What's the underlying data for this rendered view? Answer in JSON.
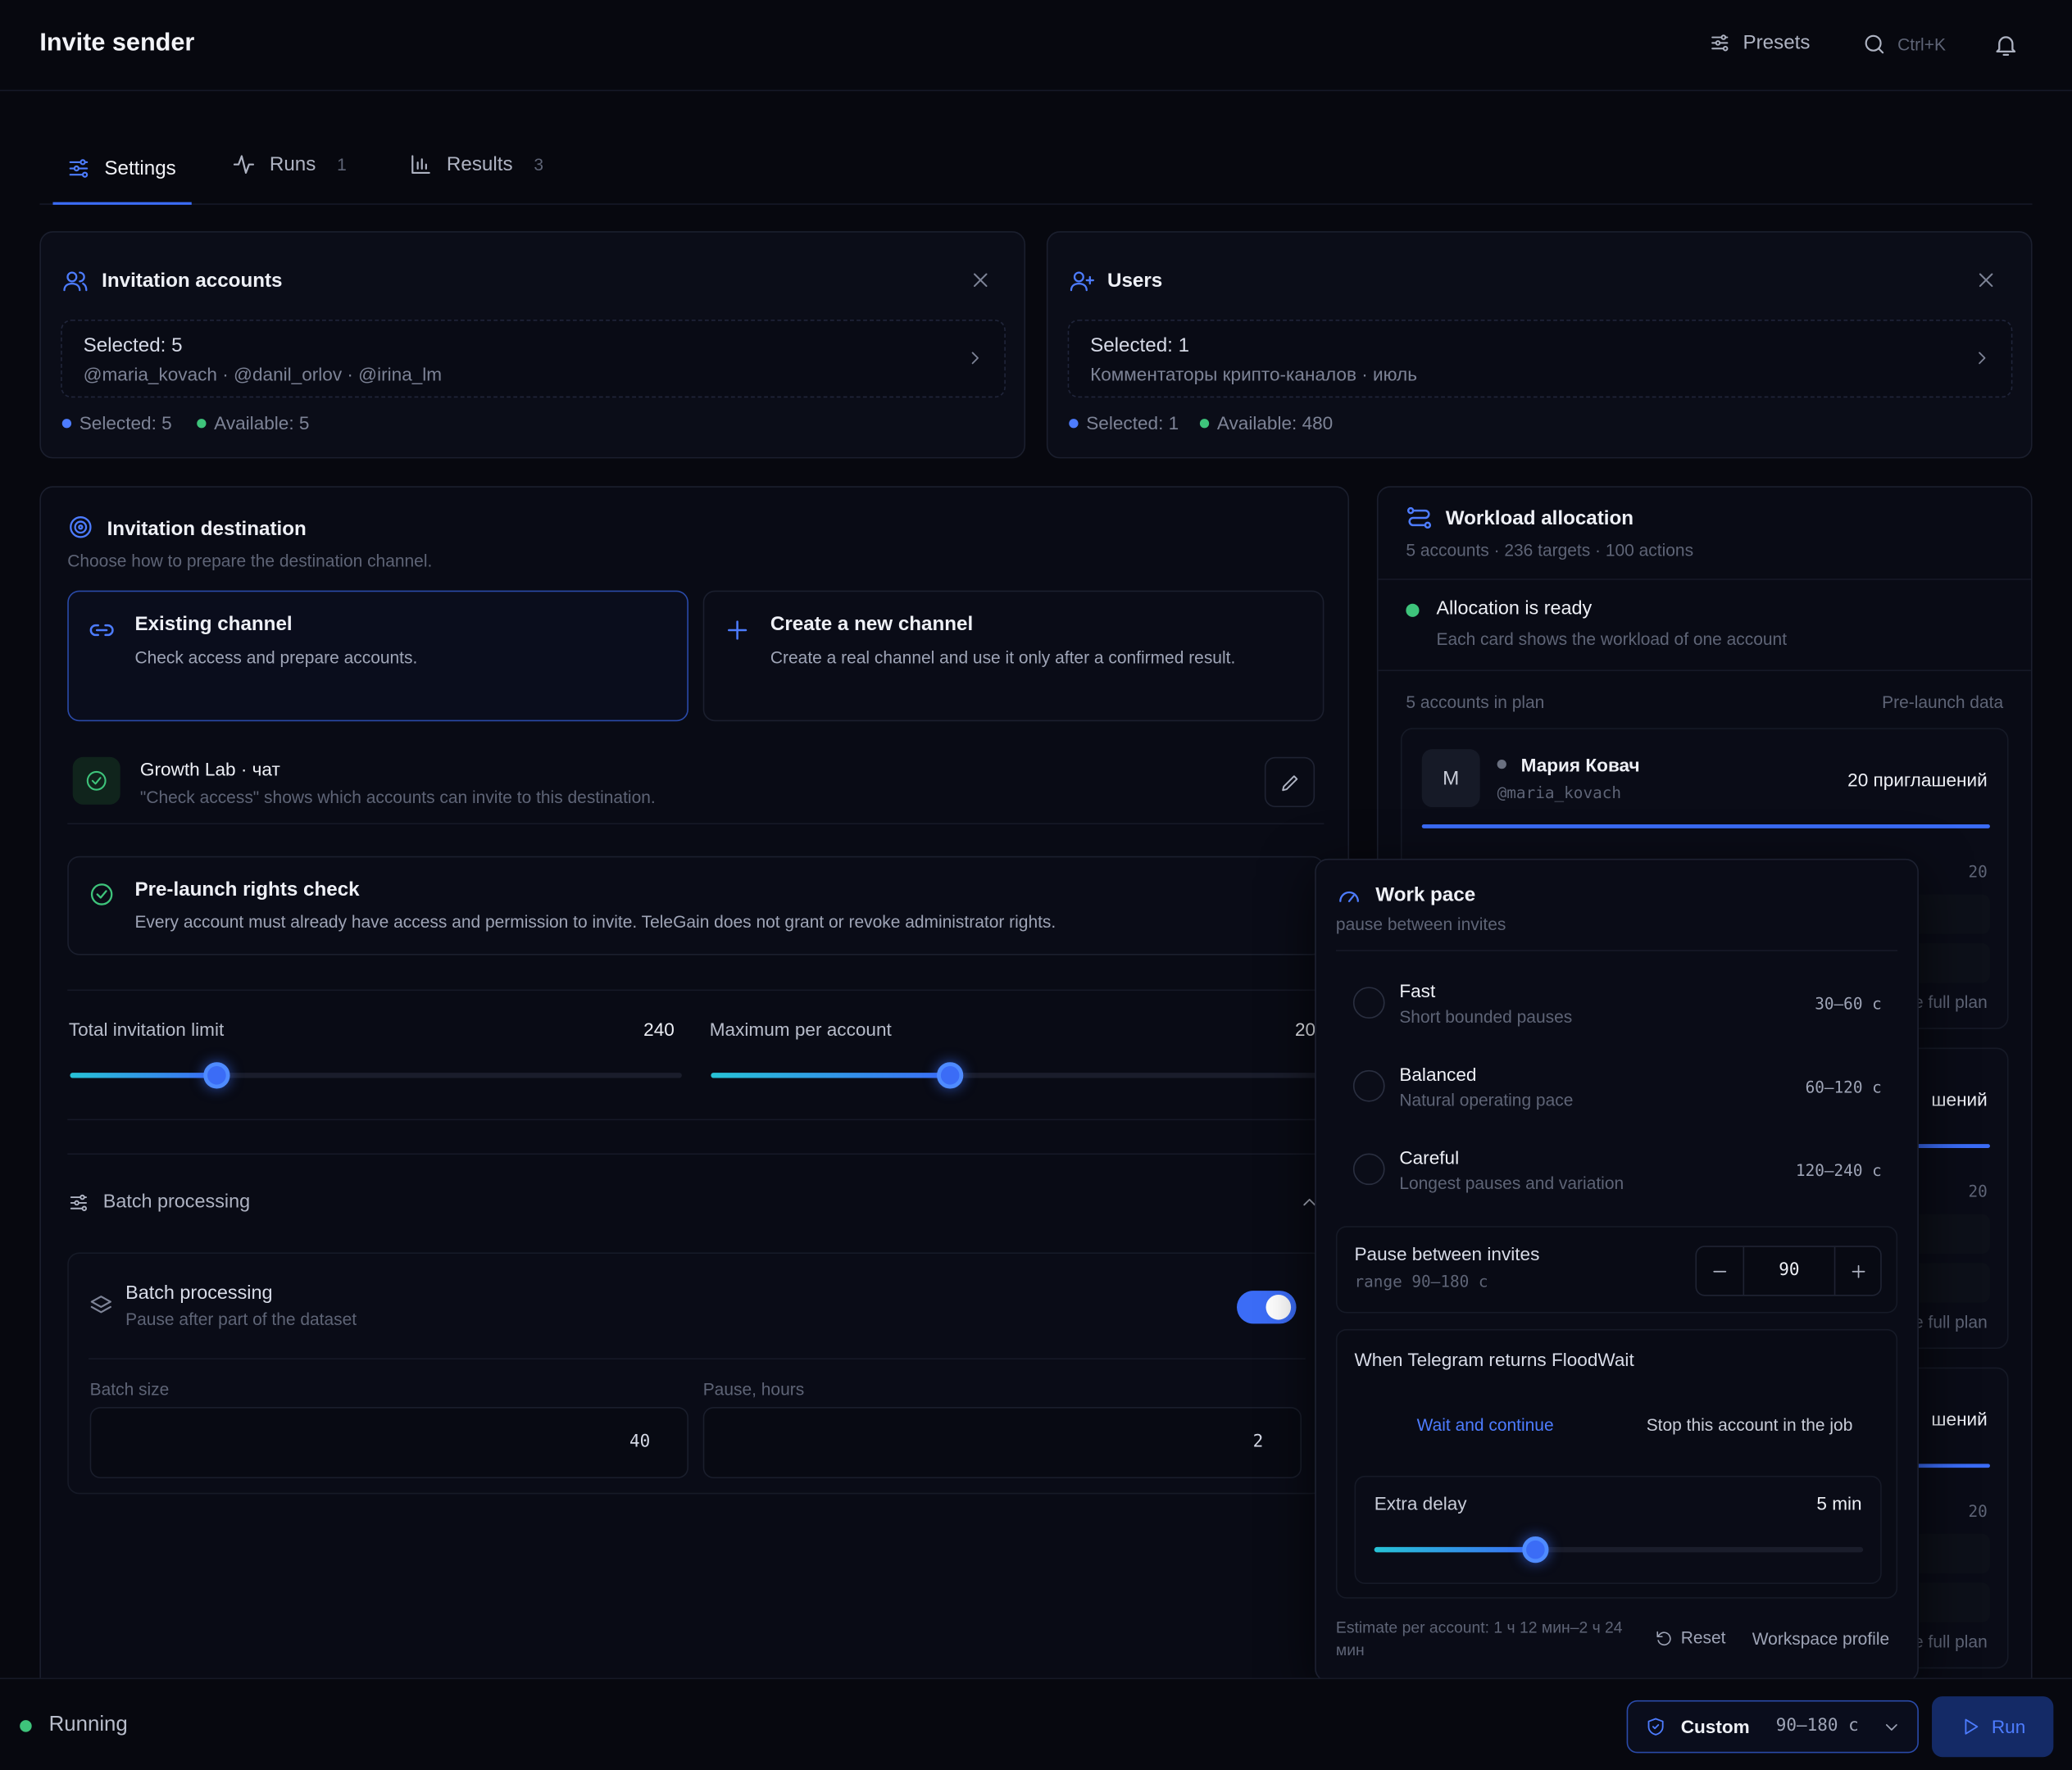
{
  "header": {
    "title": "Invite sender",
    "presets_label": "Presets",
    "search_shortcut": "Ctrl+K"
  },
  "tabs": [
    {
      "label": "Settings",
      "count": ""
    },
    {
      "label": "Runs",
      "count": "1"
    },
    {
      "label": "Results",
      "count": "3"
    }
  ],
  "accounts_card": {
    "title": "Invitation accounts",
    "selected_line": "Selected: 5",
    "usernames": "@maria_kovach · @danil_orlov · @irina_lm",
    "stat_selected": "Selected: 5",
    "stat_available": "Available: 5"
  },
  "users_card": {
    "title": "Users",
    "selected_line": "Selected: 1",
    "source": "Комментаторы крипто-каналов · июль",
    "stat_selected": "Selected: 1",
    "stat_available": "Available: 480"
  },
  "destination": {
    "title": "Invitation destination",
    "subtitle": "Choose how to prepare the destination channel.",
    "option_existing_title": "Existing channel",
    "option_existing_desc": "Check access and prepare accounts.",
    "option_new_title": "Create a new channel",
    "option_new_desc": "Create a real channel and use it only after a confirmed result.",
    "chat_name": "Growth Lab · чат",
    "chat_hint": "\"Check access\" shows which accounts can invite to this destination.",
    "rights_title": "Pre-launch rights check",
    "rights_desc": "Every account must already have access and permission to invite. TeleGain does not grant or revoke administrator rights.",
    "total_limit_label": "Total invitation limit",
    "total_limit_value": "240",
    "max_per_account_label": "Maximum per account",
    "max_per_account_value": "20",
    "total_limit_fraction": 0.24,
    "max_per_account_fraction": 0.39,
    "batch_section_label": "Batch processing",
    "batch_title": "Batch processing",
    "batch_desc": "Pause after part of the dataset",
    "batch_size_label": "Batch size",
    "batch_size_value": "40",
    "pause_hours_label": "Pause, hours",
    "pause_hours_value": "2"
  },
  "workload": {
    "title": "Workload allocation",
    "summary": "5 accounts · 236 targets · 100 actions",
    "ready_title": "Allocation is ready",
    "ready_desc": "Each card shows the workload of one account",
    "plan_label": "5 accounts in plan",
    "prelaunch_label": "Pre-launch data",
    "account_initial": "М",
    "account_name": "Мария Ковач",
    "account_handle": "@maria_kovach",
    "account_invites": "20 приглашений",
    "partial_value": "20",
    "partial_full_plan": "e full plan",
    "partial_invites": "шений"
  },
  "work_pace": {
    "title": "Work pace",
    "subtitle": "pause between invites",
    "options": [
      {
        "name": "Fast",
        "desc": "Short bounded pauses",
        "range": "30–60 с"
      },
      {
        "name": "Balanced",
        "desc": "Natural operating pace",
        "range": "60–120 с"
      },
      {
        "name": "Careful",
        "desc": "Longest pauses and variation",
        "range": "120–240 с"
      }
    ],
    "pause_label": "Pause between invites",
    "pause_range": "range 90–180 с",
    "pause_value": "90",
    "floodwait_title": "When Telegram returns FloodWait",
    "floodwait_wait": "Wait and continue",
    "floodwait_stop": "Stop this account in the job",
    "extra_delay_label": "Extra delay",
    "extra_delay_value": "5 min",
    "extra_delay_fraction": 0.33,
    "estimate": "Estimate per account: 1 ч 12 мин–2 ч 24 мин",
    "reset_label": "Reset",
    "workspace_label": "Workspace profile"
  },
  "footer": {
    "status": "Running",
    "preset_name": "Custom",
    "preset_range": "90–180 с",
    "run_label": "Run"
  },
  "colors": {
    "accent": "#3b6cf6",
    "success": "#3ec47b",
    "background": "#07080f"
  }
}
